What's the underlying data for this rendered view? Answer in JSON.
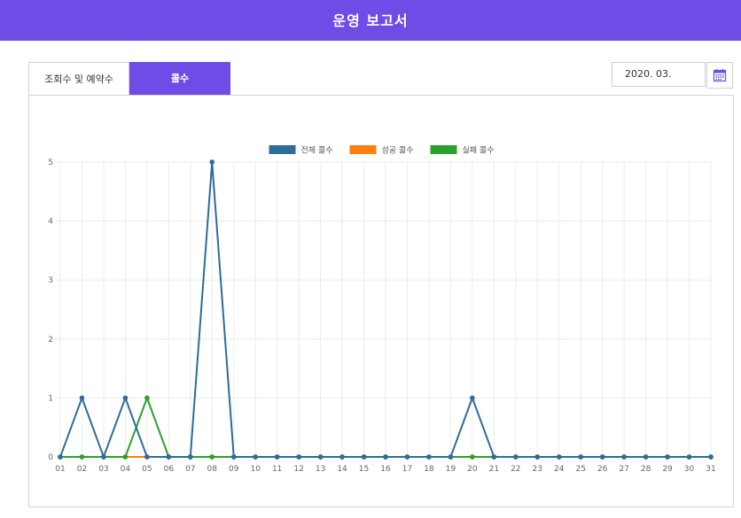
{
  "header": {
    "title": "운영 보고서"
  },
  "tabs": [
    {
      "label": "조회수 및 예약수",
      "active": false
    },
    {
      "label": "콜수",
      "active": true
    }
  ],
  "date_picker": {
    "value": "2020. 03.",
    "icon": "calendar-icon"
  },
  "colors": {
    "header": "#6f4ce6",
    "total": "#2e6c99",
    "success": "#ff7f0e",
    "fail": "#2ca02c"
  },
  "chart_data": {
    "type": "line",
    "title": "",
    "xlabel": "",
    "ylabel": "",
    "ylim": [
      0,
      5
    ],
    "yticks": [
      "0",
      "1",
      "2",
      "3",
      "4",
      "5"
    ],
    "legend_position": "top-center",
    "grid": true,
    "categories": [
      "01",
      "02",
      "03",
      "04",
      "05",
      "06",
      "07",
      "08",
      "09",
      "10",
      "11",
      "12",
      "13",
      "14",
      "15",
      "16",
      "17",
      "18",
      "19",
      "20",
      "21",
      "22",
      "23",
      "24",
      "25",
      "26",
      "27",
      "28",
      "29",
      "30",
      "31"
    ],
    "series": [
      {
        "name": "전체 콜수",
        "color": "#2e6c99",
        "values": [
          0,
          1,
          0,
          1,
          0,
          0,
          0,
          5,
          0,
          0,
          0,
          0,
          0,
          0,
          0,
          0,
          0,
          0,
          0,
          1,
          0,
          0,
          0,
          0,
          0,
          0,
          0,
          0,
          0,
          0,
          0
        ]
      },
      {
        "name": "성공 콜수",
        "color": "#ff7f0e",
        "values": [
          0,
          0,
          0,
          0,
          0,
          0,
          0,
          0,
          0,
          0,
          0,
          0,
          0,
          0,
          0,
          0,
          0,
          0,
          0,
          0,
          0,
          0,
          0,
          0,
          0,
          0,
          0,
          0,
          0,
          0,
          0
        ]
      },
      {
        "name": "실패 콜수",
        "color": "#2ca02c",
        "values": [
          0,
          0,
          0,
          0,
          1,
          0,
          0,
          0,
          0,
          0,
          0,
          0,
          0,
          0,
          0,
          0,
          0,
          0,
          0,
          0,
          0,
          0,
          0,
          0,
          0,
          0,
          0,
          0,
          0,
          0,
          0
        ]
      }
    ]
  }
}
